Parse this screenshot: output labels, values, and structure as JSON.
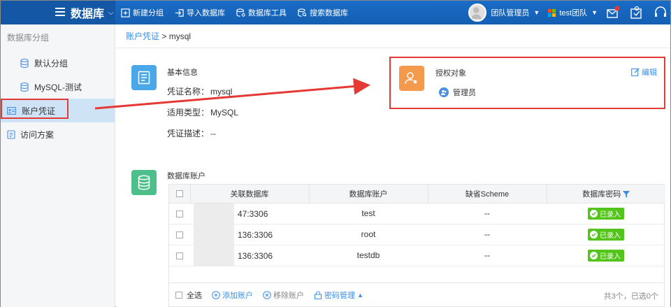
{
  "topbar": {
    "title": "数据库",
    "tools": [
      "新建分组",
      "导入数据库",
      "数据库工具",
      "搜索数据库"
    ],
    "user": "团队管理员",
    "team": "test团队"
  },
  "sidebar": {
    "heading": "数据库分组",
    "groups": [
      "默认分组",
      "MySQL-测试"
    ],
    "items": [
      "账户凭证",
      "访问方案"
    ]
  },
  "breadcrumb": {
    "parent": "账户凭证",
    "separator": ">",
    "current": "mysql"
  },
  "basic": {
    "title": "基本信息",
    "name_label": "凭证名称：",
    "name_value": "mysql",
    "type_label": "适用类型：",
    "type_value": "MySQL",
    "desc_label": "凭证描述：",
    "desc_value": "--"
  },
  "auth": {
    "title": "授权对象",
    "edit_label": "编辑",
    "member": "管理员"
  },
  "accounts": {
    "title": "数据库账户",
    "columns": [
      "关联数据库",
      "数据库账户",
      "缺省Scheme",
      "数据库密码"
    ],
    "rows": [
      {
        "host_tail": "47:3306",
        "account": "test",
        "scheme": "--",
        "password": "已录入"
      },
      {
        "host_tail": "136:3306",
        "account": "root",
        "scheme": "--",
        "password": "已录入"
      },
      {
        "host_tail": "136:3306",
        "account": "testdb",
        "scheme": "--",
        "password": "已录入"
      }
    ],
    "footer": {
      "select_all": "全选",
      "add": "添加账户",
      "remove": "移除账户",
      "pwd_manage": "密码管理",
      "count": "共3个，已选0个"
    }
  },
  "colors": {
    "topbar": "#1a6cc7",
    "accent": "#3a8ee6",
    "highlight_red": "#e53935",
    "badge_green": "#52c41a"
  }
}
